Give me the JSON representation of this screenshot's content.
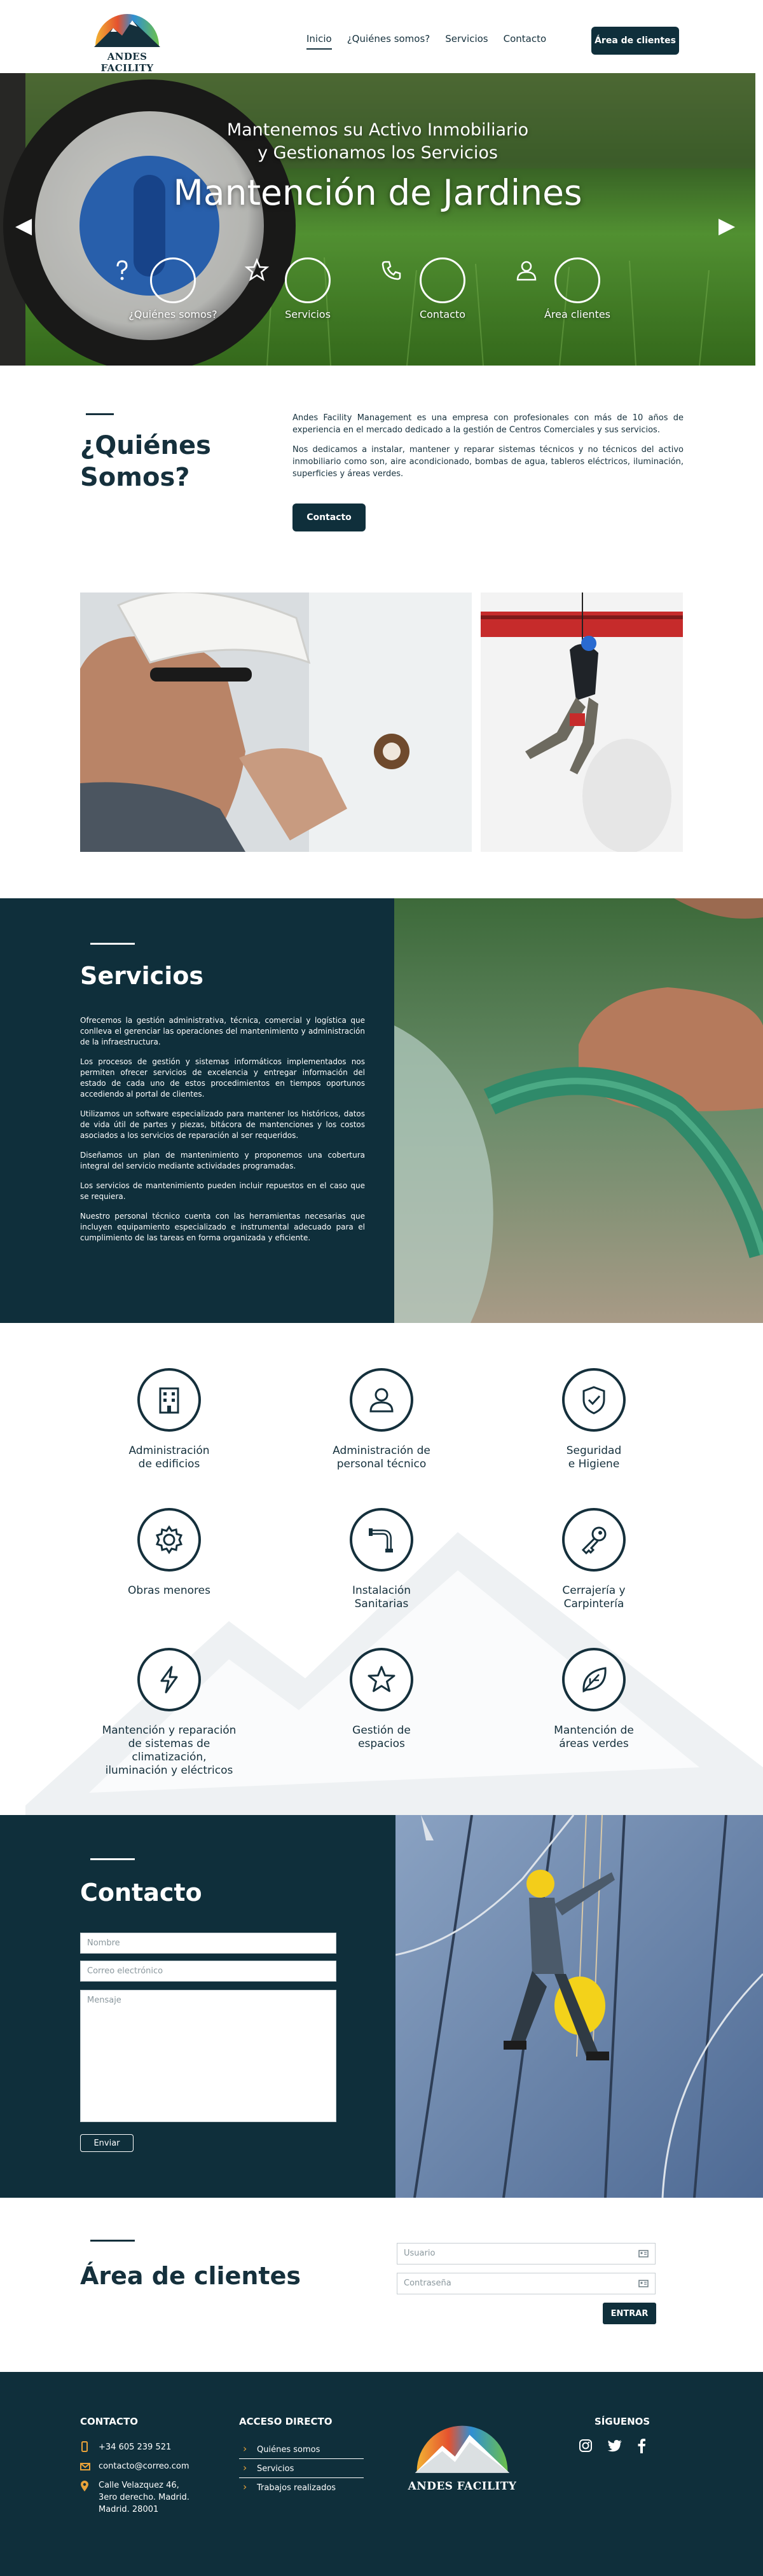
{
  "header": {
    "brand": "ANDES FACILITY",
    "nav": [
      "Inicio",
      "¿Quiénes somos?",
      "Servicios",
      "Contacto"
    ],
    "client_button": "Área de clientes"
  },
  "hero": {
    "subtitle_line1": "Mantenemos su Activo Inmobiliario",
    "subtitle_line2": "y Gestionamos los Servicios",
    "title": "Mantención de Jardines",
    "icons": [
      {
        "label": "¿Quiénes somos?",
        "icon": "question-icon"
      },
      {
        "label": "Servicios",
        "icon": "star-icon"
      },
      {
        "label": "Contacto",
        "icon": "phone-icon"
      },
      {
        "label": "Área clientes",
        "icon": "user-icon"
      }
    ]
  },
  "about": {
    "title_line1": "¿Quiénes",
    "title_line2": "Somos?",
    "p1": "Andes Facility Management es una empresa con profesionales con más de 10 años de experiencia en el mercado dedicado a la gestión de Centros Comerciales y sus servicios.",
    "p2": "Nos dedicamos a instalar, mantener y reparar sistemas técnicos y no técnicos del activo inmobiliario como son, aire acondicionado, bombas de agua, tableros eléctricos, iluminación, superficies y áreas verdes.",
    "button": "Contacto"
  },
  "services_intro": {
    "title": "Servicios",
    "paragraphs": [
      "Ofrecemos la gestión administrativa, técnica, comercial y logística que conlleva el gerenciar las operaciones del mantenimiento y administración de la infraestructura.",
      "Los procesos de gestión y sistemas informáticos implementados nos permiten ofrecer servicios de excelencia y entregar información del estado de cada uno de estos procedimientos en tiempos oportunos accediendo al portal de clientes.",
      "Utilizamos un software especializado para mantener los históricos, datos de vida útil de partes y piezas, bitácora de mantenciones y los costos asociados a los servicios de reparación al ser requeridos.",
      "Diseñamos un plan de mantenimiento y proponemos una cobertura integral del servicio mediante actividades programadas.",
      "Los servicios de mantenimiento pueden incluir repuestos en el caso que se requiera.",
      "Nuestro personal técnico cuenta con las herramientas necesarias que incluyen equipamiento especializado e instrumental adecuado para el cumplimiento de las tareas en forma organizada y eficiente."
    ]
  },
  "services": [
    {
      "l1": "Administración",
      "l2": "de edificios",
      "l3": "",
      "icon": "building-icon"
    },
    {
      "l1": "Administración de",
      "l2": "personal técnico",
      "l3": "",
      "icon": "person-icon"
    },
    {
      "l1": "Seguridad",
      "l2": "e Higiene",
      "l3": "",
      "icon": "shield-check-icon"
    },
    {
      "l1": "Obras menores",
      "l2": "",
      "l3": "",
      "icon": "gear-icon"
    },
    {
      "l1": "Instalación",
      "l2": "Sanitarias",
      "l3": "",
      "icon": "pipe-icon"
    },
    {
      "l1": "Cerrajería y",
      "l2": "Carpintería",
      "l3": "",
      "icon": "key-icon"
    },
    {
      "l1": "Mantención y reparación",
      "l2": "de sistemas de climatización,",
      "l3": "iluminación y eléctricos",
      "icon": "lightning-icon"
    },
    {
      "l1": "Gestión de",
      "l2": "espacios",
      "l3": "",
      "icon": "star-icon"
    },
    {
      "l1": "Mantención de",
      "l2": "áreas verdes",
      "l3": "",
      "icon": "leaf-icon"
    }
  ],
  "contact": {
    "title": "Contacto",
    "name_placeholder": "Nombre",
    "email_placeholder": "Correo electrónico",
    "message_placeholder": "Mensaje",
    "send": "Enviar"
  },
  "clients": {
    "title": "Área de clientes",
    "user_placeholder": "Usuario",
    "password_placeholder": "Contraseña",
    "enter": "ENTRAR"
  },
  "footer": {
    "contact_title": "CONTACTO",
    "phone": "+34 605 239 521",
    "email": "contacto@correo.com",
    "addr1": "Calle Velazquez 46,",
    "addr2": "3ero derecho. Madrid.",
    "addr3": "Madrid. 28001",
    "access_title": "ACCESO DIRECTO",
    "links": [
      "Quiénes somos",
      "Servicios",
      "Trabajos realizados"
    ],
    "brand": "ANDES FACILITY",
    "follow_title": "SÍGUENOS"
  },
  "colors": {
    "primary": "#0f2f3b",
    "accent": "#e8a23a"
  }
}
